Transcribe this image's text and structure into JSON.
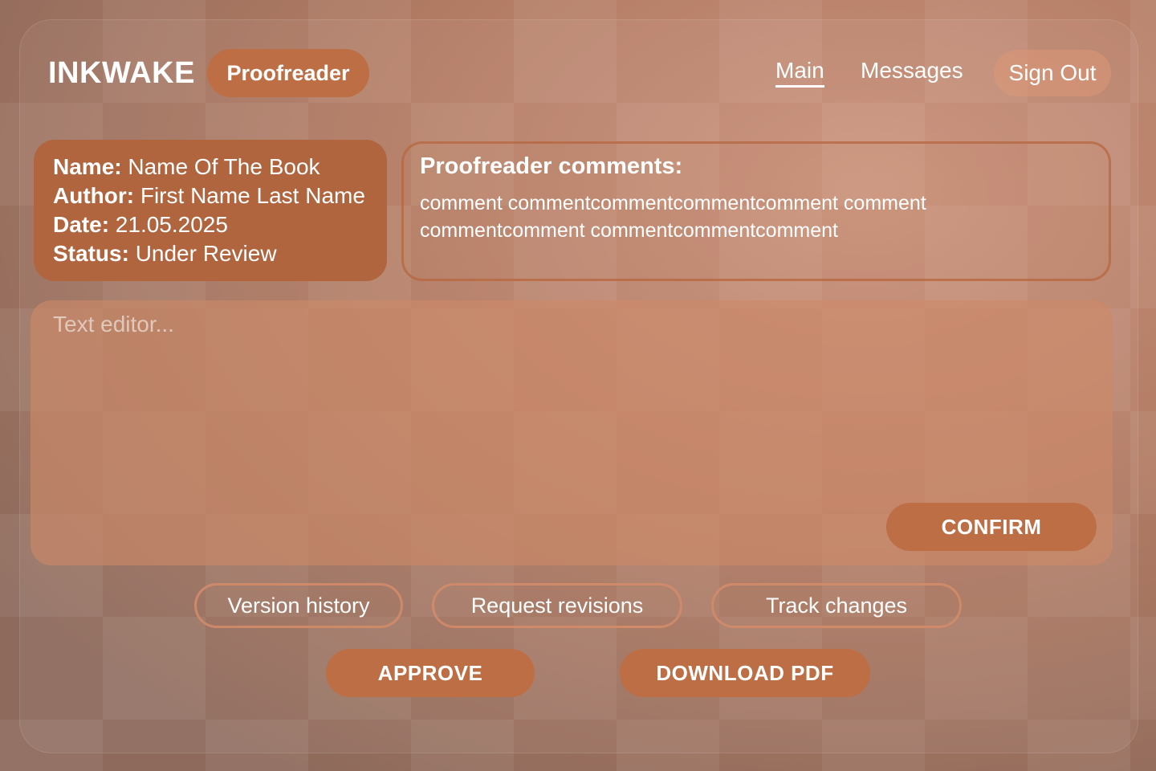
{
  "header": {
    "brand": "INKWAKE",
    "role": "Proofreader",
    "nav": {
      "main": "Main",
      "messages": "Messages",
      "sign_out": "Sign Out"
    }
  },
  "book": {
    "name_label": "Name:",
    "name_value": "Name Of The Book",
    "author_label": "Author:",
    "author_value": "First Name Last Name",
    "date_label": "Date:",
    "date_value": "21.05.2025",
    "status_label": "Status:",
    "status_value": "Under Review"
  },
  "comments": {
    "title": "Proofreader comments:",
    "text": "comment commentcommentcommentcomment comment commentcomment commentcommentcomment"
  },
  "editor": {
    "placeholder": "Text editor...",
    "confirm_label": "CONFIRM"
  },
  "actions": {
    "version_history": "Version history",
    "request_revisions": "Request revisions",
    "track_changes": "Track changes",
    "approve": "APPROVE",
    "download_pdf": "DOWNLOAD PDF"
  },
  "colors": {
    "accent": "#bd6e45",
    "card": "#b0653f",
    "text": "#ffffff"
  }
}
